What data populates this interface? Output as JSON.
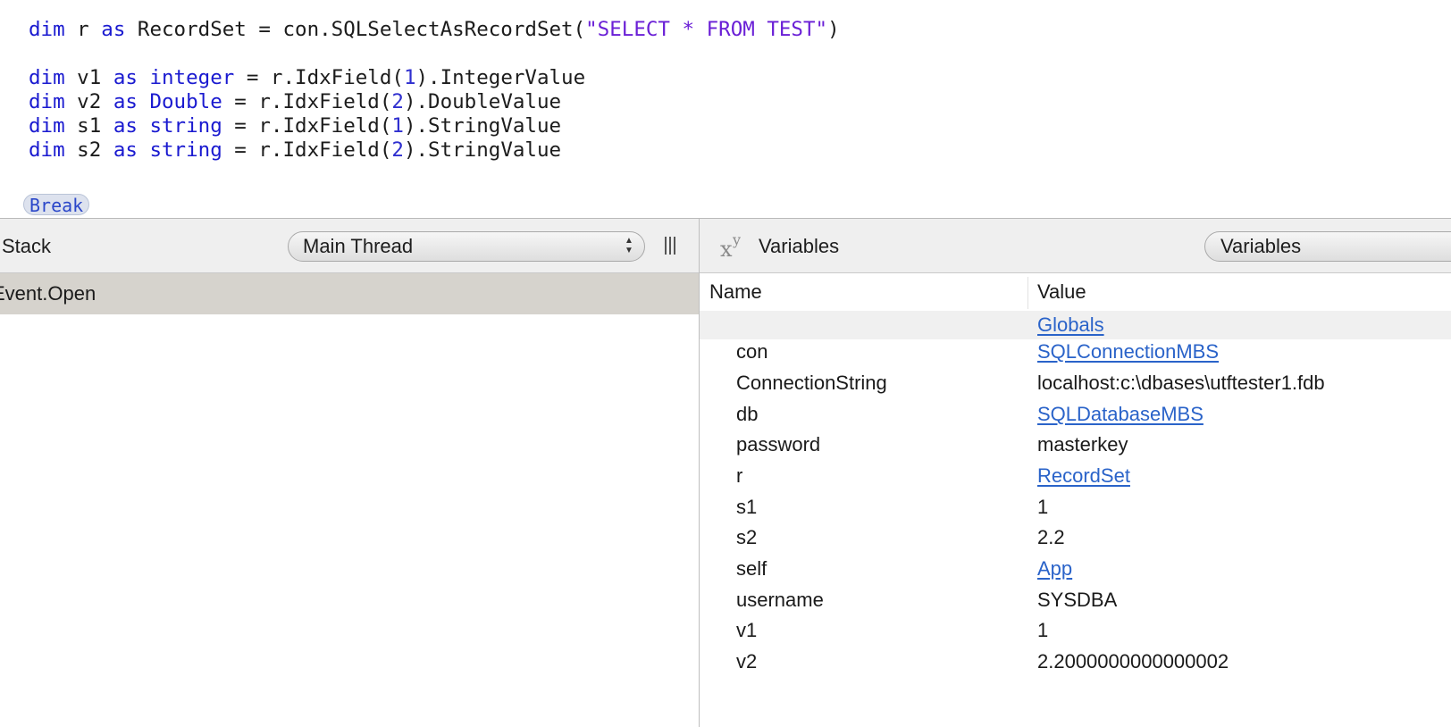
{
  "editor": {
    "lines": [
      [
        {
          "t": "dim",
          "k": "kw"
        },
        {
          "t": " r "
        },
        {
          "t": "as",
          "k": "kw"
        },
        {
          "t": " RecordSet = con.SQLSelectAsRecordSet("
        },
        {
          "t": "\"SELECT * FROM TEST\"",
          "k": "str"
        },
        {
          "t": ")"
        }
      ],
      [
        {
          "t": "dim",
          "k": "kw"
        },
        {
          "t": " v1 "
        },
        {
          "t": "as",
          "k": "kw"
        },
        {
          "t": " "
        },
        {
          "t": "integer",
          "k": "kw"
        },
        {
          "t": " = r.IdxField("
        },
        {
          "t": "1",
          "k": "num"
        },
        {
          "t": ").IntegerValue"
        }
      ],
      [
        {
          "t": "dim",
          "k": "kw"
        },
        {
          "t": " v2 "
        },
        {
          "t": "as",
          "k": "kw"
        },
        {
          "t": " "
        },
        {
          "t": "Double",
          "k": "kw"
        },
        {
          "t": " = r.IdxField("
        },
        {
          "t": "2",
          "k": "num"
        },
        {
          "t": ").DoubleValue"
        }
      ],
      [
        {
          "t": "dim",
          "k": "kw"
        },
        {
          "t": " s1 "
        },
        {
          "t": "as",
          "k": "kw"
        },
        {
          "t": " "
        },
        {
          "t": "string",
          "k": "kw"
        },
        {
          "t": " = r.IdxField("
        },
        {
          "t": "1",
          "k": "num"
        },
        {
          "t": ").StringValue"
        }
      ],
      [
        {
          "t": "dim",
          "k": "kw"
        },
        {
          "t": " s2 "
        },
        {
          "t": "as",
          "k": "kw"
        },
        {
          "t": " "
        },
        {
          "t": "string",
          "k": "kw"
        },
        {
          "t": " = r.IdxField("
        },
        {
          "t": "2",
          "k": "num"
        },
        {
          "t": ").StringValue"
        }
      ]
    ],
    "break_label": "Break"
  },
  "stack": {
    "title": "Stack",
    "thread_selected": "Main Thread",
    "rows": [
      {
        "label": "Event.Open"
      }
    ]
  },
  "variables": {
    "title": "Variables",
    "view_selected": "Variables",
    "columns": {
      "name": "Name",
      "value": "Value"
    },
    "globals_label": "Globals",
    "rows": [
      {
        "name": "con",
        "value": "SQLConnectionMBS",
        "link": true
      },
      {
        "name": "ConnectionString",
        "value": "localhost:c:\\dbases\\utftester1.fdb",
        "link": false
      },
      {
        "name": "db",
        "value": "SQLDatabaseMBS",
        "link": true
      },
      {
        "name": "password",
        "value": "masterkey",
        "link": false
      },
      {
        "name": "r",
        "value": "RecordSet",
        "link": true
      },
      {
        "name": "s1",
        "value": "1",
        "link": false
      },
      {
        "name": "s2",
        "value": "2.2",
        "link": false
      },
      {
        "name": "self",
        "value": "App",
        "link": true
      },
      {
        "name": "username",
        "value": "SYSDBA",
        "link": false
      },
      {
        "name": "v1",
        "value": "1",
        "link": false
      },
      {
        "name": "v2",
        "value": "2.2000000000000002",
        "link": false
      }
    ]
  },
  "colors": {
    "keyword": "#1a1ad0",
    "string": "#6a1fd6",
    "link": "#2a63c9",
    "selected_row": "#d6d3cd",
    "header_bg": "#efefef"
  }
}
